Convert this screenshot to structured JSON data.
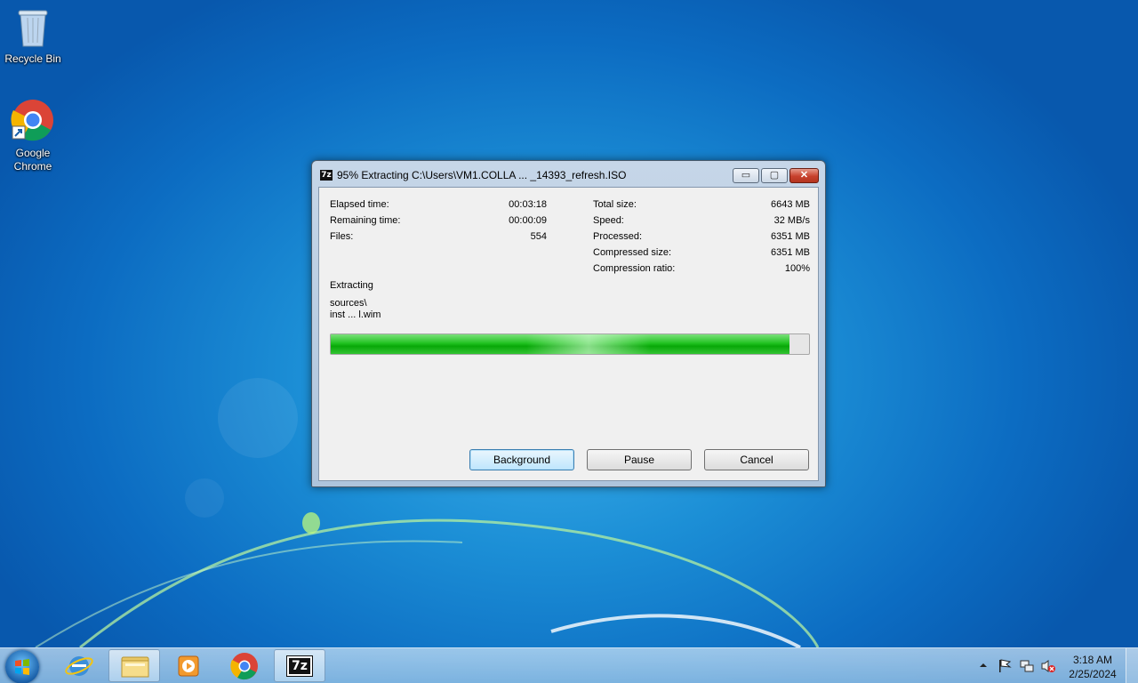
{
  "desktop": {
    "icons": [
      {
        "label": "Recycle Bin",
        "icon": "recycle-bin-icon"
      },
      {
        "label": "Google\nChrome",
        "icon": "chrome-icon"
      }
    ]
  },
  "window": {
    "title": "95% Extracting C:\\Users\\VM1.COLLA ... _14393_refresh.ISO",
    "app_icon_text": "7z",
    "left_stats": [
      {
        "label": "Elapsed time:",
        "value": "00:03:18"
      },
      {
        "label": "Remaining time:",
        "value": "00:00:09"
      },
      {
        "label": "Files:",
        "value": "554"
      }
    ],
    "right_stats": [
      {
        "label": "Total size:",
        "value": "6643 MB"
      },
      {
        "label": "Speed:",
        "value": "32 MB/s"
      },
      {
        "label": "Processed:",
        "value": "6351 MB"
      },
      {
        "label": "Compressed size:",
        "value": "6351 MB"
      },
      {
        "label": "Compression ratio:",
        "value": "100%"
      }
    ],
    "status_label": "Extracting",
    "current_path_line1": "sources\\",
    "current_path_line2": "inst ... l.wim",
    "progress_percent": 96,
    "buttons": {
      "background": "Background",
      "pause": "Pause",
      "cancel": "Cancel"
    },
    "controls": {
      "minimize": "▭",
      "maximize": "▢",
      "close": "✕"
    }
  },
  "taskbar": {
    "items": [
      "start-orb",
      "internet-explorer-icon",
      "file-explorer-icon",
      "media-player-icon",
      "chrome-icon",
      "7zip-icon"
    ],
    "seven_zip_label": "7z",
    "clock_time": "3:18 AM",
    "clock_date": "2/25/2024"
  },
  "colors": {
    "progress_green": "#14b414",
    "close_red": "#c7402c"
  }
}
